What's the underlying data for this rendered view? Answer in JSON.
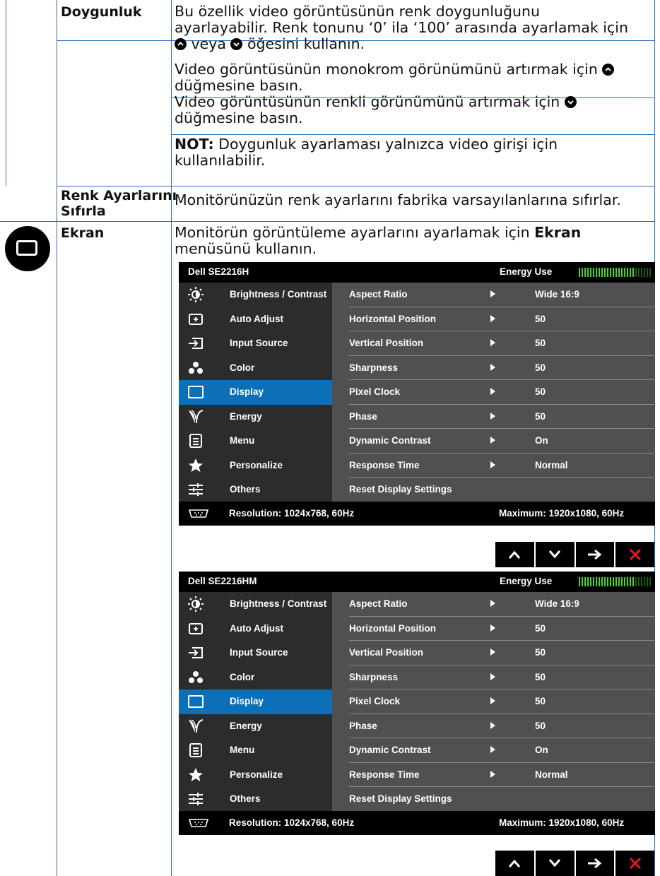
{
  "rows": {
    "doygunluk": {
      "term": "Doygunluk",
      "p1_a": "Bu özellik video görüntüsünün renk doygunluğunu",
      "p1_b": "ayarlayabilir. Renk tonunu ‘0’ ila ‘100’ arasında ayarlamak için",
      "p1_c_mid": " veya ",
      "p1_c_end": " öğesini kullanın.",
      "p2_a": "Video görüntüsünün monokrom görünümünü artırmak için ",
      "p2_b": "düğmesine basın.",
      "p2_c": "Video görüntüsünün renkli görünümünü artırmak için ",
      "p2_d": "düğmesine basın.",
      "note_label": "NOT:",
      "note_a": " Doygunluk ayarlaması yalnızca video girişi için",
      "note_b": "kullanılabilir."
    },
    "reset": {
      "term_a": "Renk Ayarlarını",
      "term_b": "Sıfırla",
      "desc": "Monitörünüzün renk ayarlarını fabrika varsayılanlarına sıfırlar."
    },
    "ekran": {
      "icon": "display-icon",
      "term": "Ekran",
      "desc_a": "Monitörün görüntüleme ayarlarını ayarlamak için ",
      "desc_bold": "Ekran",
      "desc_b": "menüsünü kullanın."
    }
  },
  "osd1": {
    "model": "Dell SE2216H",
    "energy_label": "Energy Use",
    "energy_level": 0.78,
    "resolution": "Resolution: 1024x768, 60Hz",
    "maximum": "Maximum: 1920x1080, 60Hz"
  },
  "osd2": {
    "model": "Dell SE2216HM",
    "energy_label": "Energy Use",
    "energy_level": 0.78,
    "resolution": "Resolution: 1024x768, 60Hz",
    "maximum": "Maximum: 1920x1080, 60Hz"
  },
  "menu_items": [
    {
      "label": "Brightness / Contrast",
      "icon": "brightness-icon"
    },
    {
      "label": "Auto Adjust",
      "icon": "auto-adjust-icon"
    },
    {
      "label": "Input Source",
      "icon": "input-source-icon"
    },
    {
      "label": "Color",
      "icon": "color-icon"
    },
    {
      "label": "Display",
      "icon": "display-icon",
      "selected": true
    },
    {
      "label": "Energy",
      "icon": "energy-icon"
    },
    {
      "label": "Menu",
      "icon": "menu-icon"
    },
    {
      "label": "Personalize",
      "icon": "star-icon"
    },
    {
      "label": "Others",
      "icon": "others-icon"
    }
  ],
  "settings": [
    {
      "key": "Aspect Ratio",
      "value": "Wide 16:9"
    },
    {
      "key": "Horizontal Position",
      "value": "50"
    },
    {
      "key": "Vertical Position",
      "value": "50"
    },
    {
      "key": "Sharpness",
      "value": "50"
    },
    {
      "key": "Pixel Clock",
      "value": "50"
    },
    {
      "key": "Phase",
      "value": "50"
    },
    {
      "key": "Dynamic Contrast",
      "value": "On"
    },
    {
      "key": "Response Time",
      "value": "Normal"
    },
    {
      "key": "Reset Display Settings",
      "value": ""
    }
  ],
  "nav_buttons": [
    "up-icon",
    "down-icon",
    "enter-icon",
    "exit-icon"
  ]
}
